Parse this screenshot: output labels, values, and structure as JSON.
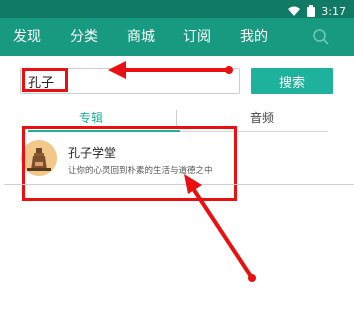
{
  "status_bar": {
    "time": "3:17"
  },
  "nav": {
    "items": [
      {
        "label": "发现"
      },
      {
        "label": "分类"
      },
      {
        "label": "商城"
      },
      {
        "label": "订阅"
      },
      {
        "label": "我的"
      }
    ]
  },
  "search": {
    "value": "孔子",
    "button_label": "搜索"
  },
  "tabs": [
    {
      "label": "专辑",
      "active": true
    },
    {
      "label": "音频",
      "active": false
    }
  ],
  "results": [
    {
      "title": "孔子学堂",
      "subtitle": "让你的心灵回到朴素的生活与道德之中"
    }
  ],
  "colors": {
    "status_bar": "#117a64",
    "nav_bar": "#179a80",
    "accent": "#1eb19b",
    "annotation_red": "#e81010"
  }
}
